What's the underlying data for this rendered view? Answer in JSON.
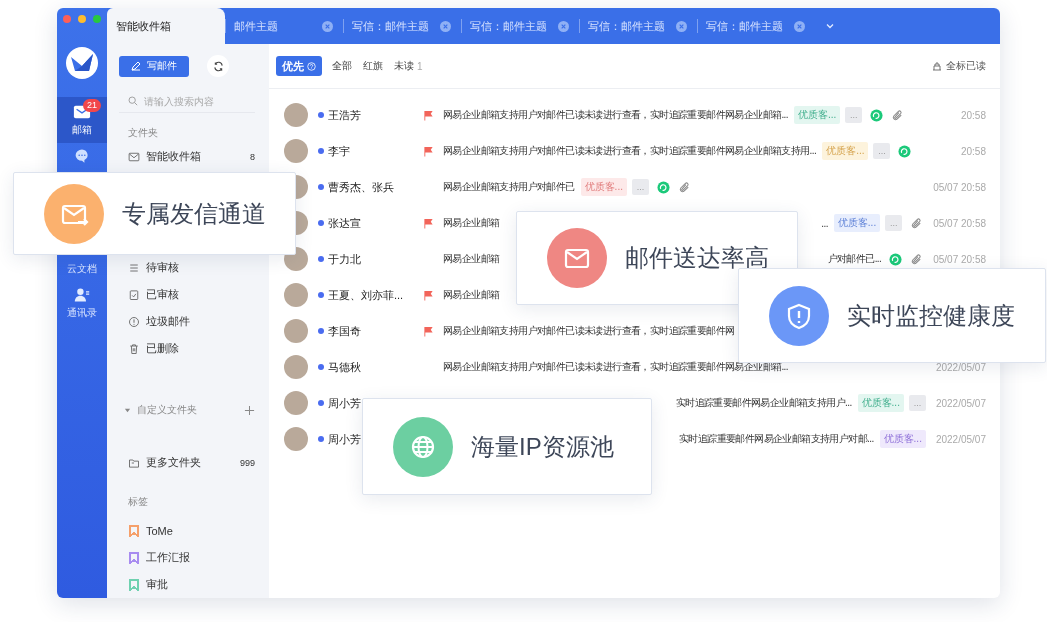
{
  "tabs": [
    {
      "label": "智能收件箱",
      "selected": true,
      "closable": false
    },
    {
      "label": "邮件主题",
      "selected": false,
      "closable": true
    },
    {
      "label": "写信：邮件主题",
      "selected": false,
      "closable": true
    },
    {
      "label": "写信：邮件主题",
      "selected": false,
      "closable": true
    },
    {
      "label": "写信：邮件主题",
      "selected": false,
      "closable": true
    },
    {
      "label": "写信：邮件主题",
      "selected": false,
      "closable": true
    }
  ],
  "rail": [
    {
      "kind": "mail",
      "label": "邮箱",
      "selected": true,
      "badge": "21"
    },
    {
      "kind": "chat",
      "selected": false
    },
    {
      "kind": "docs",
      "label": "云文档",
      "selected": false
    },
    {
      "kind": "contacts",
      "label": "通讯录",
      "selected": false
    }
  ],
  "folder_panel": {
    "compose": "写邮件",
    "search": {
      "placeholder": "请输入搜索内容"
    },
    "folders_title": "文件夹",
    "folders": [
      {
        "kind": "inbox",
        "label": "智能收件箱",
        "count": "8"
      }
    ],
    "folders_below": [
      {
        "kind": "review",
        "label": "待审核"
      },
      {
        "kind": "reviewed",
        "label": "已审核"
      },
      {
        "kind": "spam",
        "label": "垃圾邮件"
      },
      {
        "kind": "trash",
        "label": "已删除"
      }
    ],
    "custom_title": "自定义文件夹",
    "expanded": true,
    "custom_folders": [
      {
        "kind": "folder",
        "label": "更多文件夹",
        "count": "999"
      }
    ],
    "tags_title": "标签",
    "tags": [
      {
        "label": "ToMe",
        "color": "#f5a06b"
      },
      {
        "label": "工作汇报",
        "color": "#a88cf0"
      },
      {
        "label": "审批",
        "color": "#6fd1b0"
      }
    ]
  },
  "filters": [
    {
      "label": "优先",
      "selected": true,
      "help": true
    },
    {
      "label": "全部",
      "selected": false
    },
    {
      "label": "红旗",
      "selected": false
    },
    {
      "label": "未读",
      "selected": false,
      "count": "1"
    }
  ],
  "mark_all_read": "全标已读",
  "mails": [
    {
      "sender": "王浩芳",
      "unread": true,
      "flagged": true,
      "subject": "网易企业邮箱支持用户对邮件已读未读进行查看，实时追踪重要邮件网易企业邮箱...",
      "tags": [
        {
          "label": "优质客...",
          "color": "#e3f6f0"
        }
      ],
      "more": "...",
      "chat": true,
      "attachment": true,
      "time": "20:58"
    },
    {
      "sender": "李宇",
      "unread": true,
      "flagged": true,
      "subject": "网易企业邮箱支持用户对邮件已读未读进行查看，实时追踪重要邮件网易企业邮箱支持用...",
      "tags": [
        {
          "label": "优质客...",
          "color": "#fdf3dc"
        }
      ],
      "more": "...",
      "chat": true,
      "attachment": false,
      "time": "20:58"
    },
    {
      "sender": "曹秀杰、张兵",
      "unread": true,
      "flagged": false,
      "subject": "网易企业邮箱支持用户对邮件已",
      "tags": [
        {
          "label": "优质客...",
          "color": "#fde9e9"
        }
      ],
      "more": "...",
      "chat": true,
      "attachment": true,
      "time": "05/07 20:58"
    },
    {
      "sender": "张达宣",
      "unread": true,
      "flagged": true,
      "subject": "网易企业邮箱",
      "subject_tail": "...",
      "tags": [
        {
          "label": "优质客...",
          "color": "#e8eefd"
        }
      ],
      "more": "...",
      "chat": false,
      "attachment": true,
      "time": "05/07 20:58"
    },
    {
      "sender": "于力北",
      "unread": true,
      "flagged": false,
      "subject": "网易企业邮箱",
      "subject_tail": "户对邮件已...",
      "chat": true,
      "attachment": true,
      "time": "05/07 20:58"
    },
    {
      "sender": "王夏、刘亦菲...",
      "unread": true,
      "flagged": true,
      "subject": "网易企业邮箱",
      "chat": false,
      "attachment": false
    },
    {
      "sender": "李国奇",
      "unread": true,
      "flagged": true,
      "subject": "网易企业邮箱支持用户对邮件已读未读进行查看，实时追踪重要邮件网",
      "chat": false,
      "attachment": false
    },
    {
      "sender": "马德秋",
      "unread": true,
      "flagged": false,
      "subject": "网易企业邮箱支持用户对邮件已读未读进行查看，实时追踪重要邮件网易企业邮箱...",
      "chat": false,
      "attachment": false,
      "time": "2022/05/07"
    },
    {
      "sender": "周小芳",
      "unread": true,
      "flagged": false,
      "subject_tail": "实时追踪重要邮件网易企业邮箱支持用户...",
      "tags": [
        {
          "label": "优质客...",
          "color": "#e3f6f0"
        }
      ],
      "more": "...",
      "chat": false,
      "attachment": false,
      "time": "2022/05/07"
    },
    {
      "sender": "周小芳",
      "unread": true,
      "flagged": false,
      "subject_tail": "实时追踪重要邮件网易企业邮箱支持用户对邮...",
      "tags": [
        {
          "label": "优质客...",
          "color": "#efe9fc"
        }
      ],
      "chat": false,
      "attachment": false,
      "time": "2022/05/07"
    }
  ],
  "features": [
    {
      "kind": "send",
      "label": "专属发信通道",
      "color": "#fbb16e"
    },
    {
      "kind": "mail",
      "label": "邮件送达率高",
      "color": "#ef8783"
    },
    {
      "kind": "shield",
      "label": "实时监控健康度",
      "color": "#6b97f7"
    },
    {
      "kind": "globe",
      "label": "海量IP资源池",
      "color": "#6ccfa1"
    }
  ]
}
